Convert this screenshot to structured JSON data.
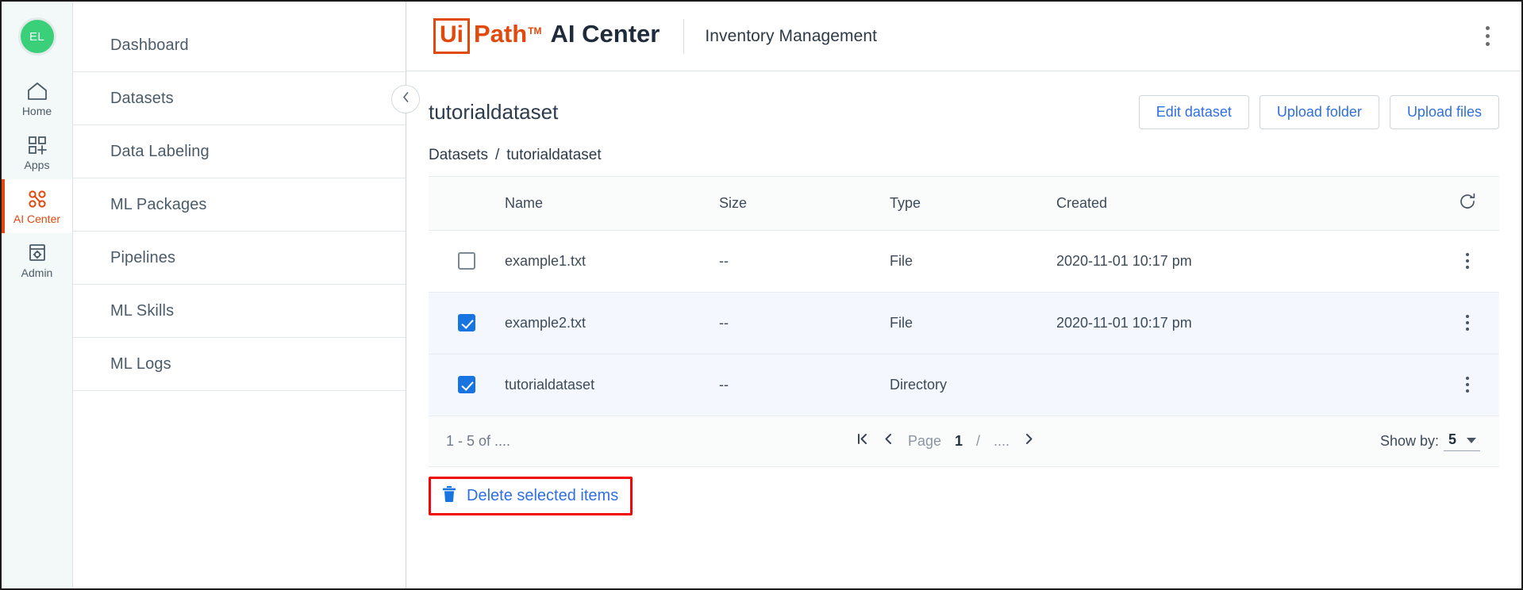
{
  "topbar": {
    "avatar_initials": "EL",
    "logo_ui": "Ui",
    "logo_path": "Path",
    "logo_tm": "TM",
    "logo_product": "AI Center",
    "title": "Inventory Management",
    "menu_icon": "kebab-menu-icon"
  },
  "rail": {
    "items": [
      {
        "label": "Home",
        "icon": "home-icon",
        "active": false
      },
      {
        "label": "Apps",
        "icon": "apps-grid-plus-icon",
        "active": false
      },
      {
        "label": "AI Center",
        "icon": "ai-center-nodes-icon",
        "active": true
      },
      {
        "label": "Admin",
        "icon": "admin-gear-panel-icon",
        "active": false
      }
    ]
  },
  "subnav": {
    "collapse_icon": "chevron-left-icon",
    "items": [
      {
        "label": "Dashboard"
      },
      {
        "label": "Datasets"
      },
      {
        "label": "Data Labeling"
      },
      {
        "label": "ML Packages"
      },
      {
        "label": "Pipelines"
      },
      {
        "label": "ML Skills"
      },
      {
        "label": "ML Logs"
      }
    ]
  },
  "main": {
    "page_title": "tutorialdataset",
    "actions": [
      {
        "label": "Edit dataset",
        "name": "edit-dataset-button"
      },
      {
        "label": "Upload folder",
        "name": "upload-folder-button"
      },
      {
        "label": "Upload files",
        "name": "upload-files-button"
      }
    ],
    "breadcrumb": {
      "root": "Datasets",
      "separator": "/",
      "current": "tutorialdataset"
    },
    "table": {
      "columns": [
        "Name",
        "Size",
        "Type",
        "Created"
      ],
      "refresh_icon": "refresh-icon",
      "rows": [
        {
          "checked": false,
          "name": "example1.txt",
          "size": "--",
          "type": "File",
          "created": "2020-11-01 10:17 pm"
        },
        {
          "checked": true,
          "name": "example2.txt",
          "size": "--",
          "type": "File",
          "created": "2020-11-01 10:17 pm"
        },
        {
          "checked": true,
          "name": "tutorialdataset",
          "size": "--",
          "type": "Directory",
          "created": ""
        }
      ]
    },
    "pagination": {
      "range": "1 - 5 of ....",
      "first_icon": "first-page-icon",
      "prev_icon": "prev-page-icon",
      "next_icon": "next-page-icon",
      "page_label": "Page",
      "page_number": "1",
      "slash": "/",
      "total_pages": "....",
      "show_by_label": "Show by:",
      "show_by_value": "5"
    },
    "delete_bar": {
      "icon": "trash-icon",
      "label": "Delete selected items",
      "highlight_color": "#f40606"
    }
  },
  "colors": {
    "brand_orange": "#e1490d",
    "link_blue": "#2f6fe4",
    "checkbox_blue": "#1874e0",
    "avatar_green": "#3ad07a",
    "annotation_red": "#f40606"
  }
}
